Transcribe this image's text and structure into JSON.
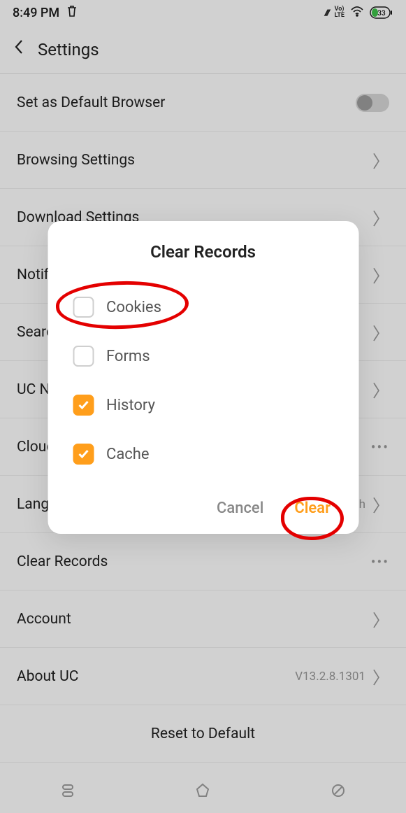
{
  "status": {
    "time": "8:49 PM",
    "battery_pct": "33"
  },
  "header": {
    "title": "Settings"
  },
  "rows": {
    "default_browser": "Set as Default Browser",
    "browsing": "Browsing Settings",
    "download": "Download Settings",
    "notif": "Notification Settings",
    "search": "Search Engine",
    "lang": "Language",
    "lang_value": "English",
    "uc": "UC News Display",
    "cloud": "Cloud Accelerate",
    "clear": "Clear Records",
    "account": "Account",
    "about": "About UC",
    "about_value": "V13.2.8.1301",
    "reset": "Reset to Default"
  },
  "dialog": {
    "title": "Clear Records",
    "items": [
      {
        "label": "Cookies",
        "checked": false
      },
      {
        "label": "Forms",
        "checked": false
      },
      {
        "label": "History",
        "checked": true
      },
      {
        "label": "Cache",
        "checked": true
      }
    ],
    "cancel": "Cancel",
    "clear": "Clear"
  }
}
